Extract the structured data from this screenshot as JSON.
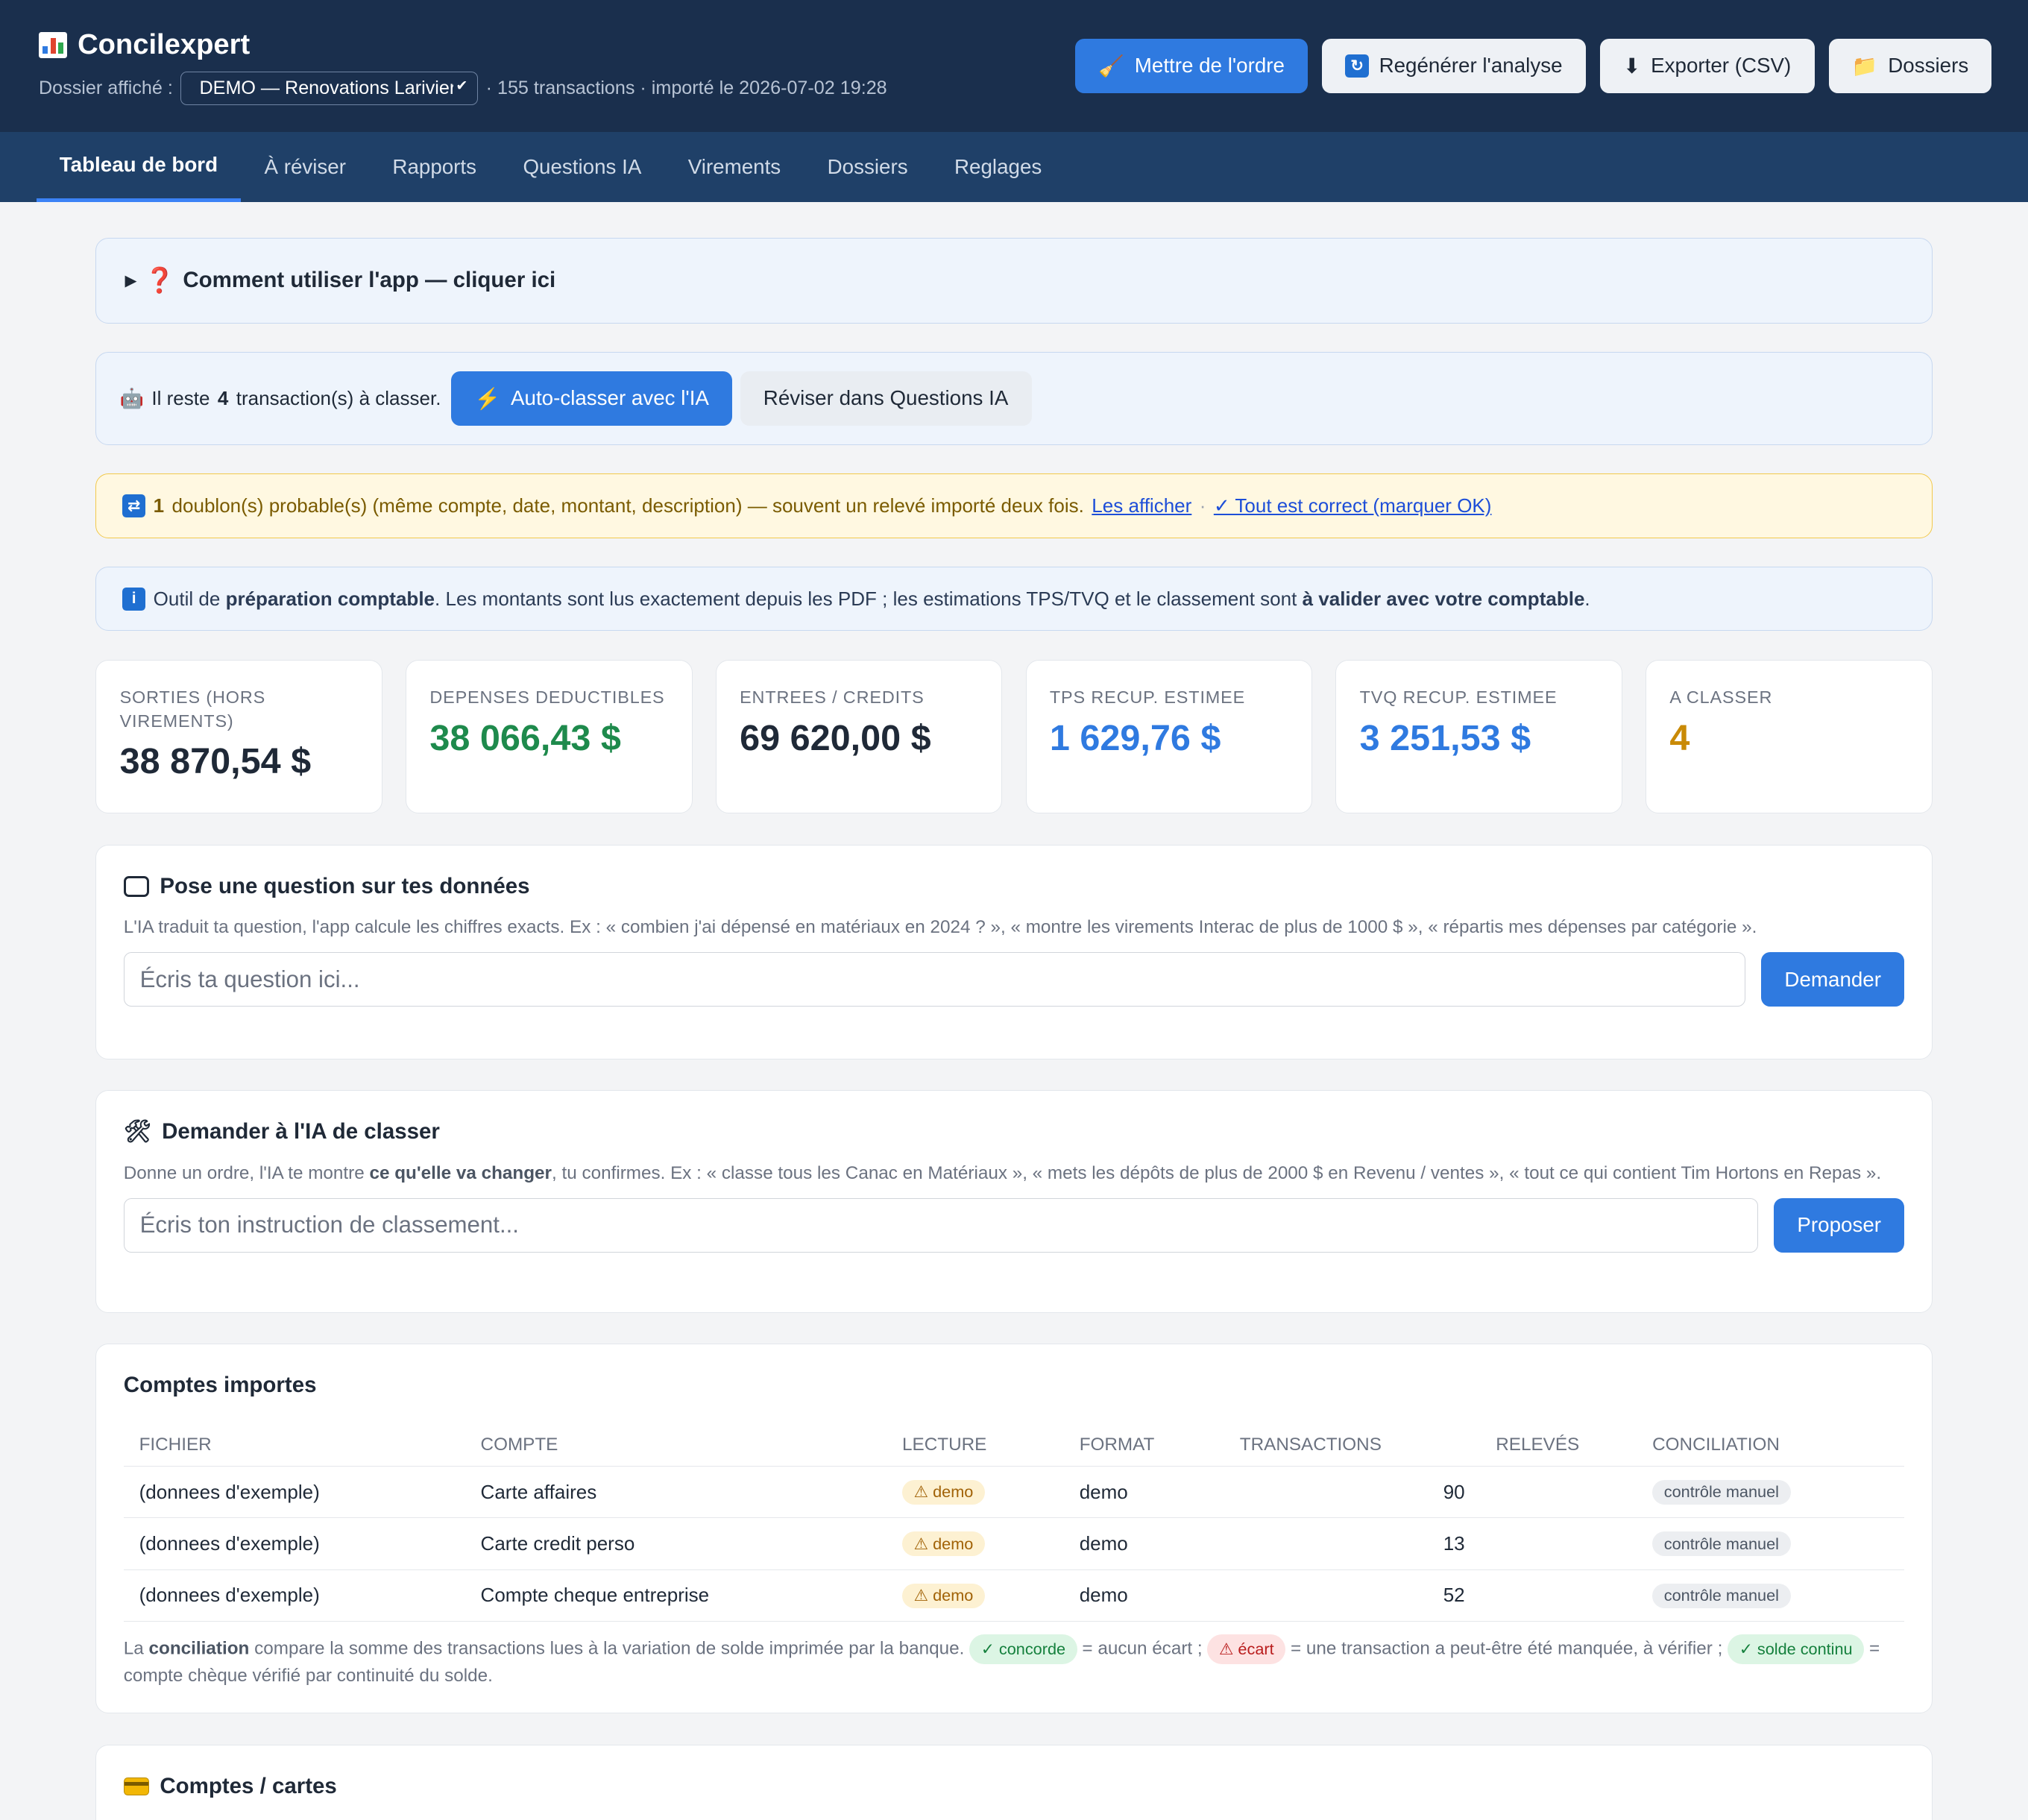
{
  "app": {
    "title": "Concilexpert",
    "dossier_label": "Dossier affiché :",
    "dossier_value": "DEMO — Renovations Lariviere",
    "dossier_meta": "· 155 transactions · importé le 2026-07-02 19:28"
  },
  "actions": {
    "tidy": "Mettre de l'ordre",
    "regen": "Regénérer l'analyse",
    "export": "Exporter (CSV)",
    "folders": "Dossiers"
  },
  "tabs": [
    "Tableau de bord",
    "À réviser",
    "Rapports",
    "Questions IA",
    "Virements",
    "Dossiers",
    "Reglages"
  ],
  "help": {
    "text": "Comment utiliser l'app — cliquer ici"
  },
  "classify": {
    "prefix": "Il reste",
    "count": "4",
    "suffix": "transaction(s) à classer.",
    "auto_button": "Auto-classer avec l'IA",
    "review_button": "Réviser dans Questions IA"
  },
  "duplicates": {
    "count": "1",
    "text": "doublon(s) probable(s) (même compte, date, montant, description) — souvent un relevé importé deux fois.",
    "show_link": "Les afficher",
    "ok_link": "✓ Tout est correct (marquer OK)"
  },
  "info": {
    "p1": "Outil de",
    "b1": "préparation comptable",
    "p2": ". Les montants sont lus exactement depuis les PDF ; les estimations TPS/TVQ et le classement sont",
    "b2": "à valider avec votre comptable",
    "p3": "."
  },
  "stats": [
    {
      "label": "Sorties (hors virements)",
      "value": "38 870,54 $",
      "color": "#1f2937"
    },
    {
      "label": "Depenses deductibles",
      "value": "38 066,43 $",
      "color": "#1e8a4c"
    },
    {
      "label": "Entrees / credits",
      "value": "69 620,00 $",
      "color": "#1f2937"
    },
    {
      "label": "TPS recup. estimee",
      "value": "1 629,76 $",
      "color": "#2f7ae0"
    },
    {
      "label": "TVQ recup. estimee",
      "value": "3 251,53 $",
      "color": "#2f7ae0"
    },
    {
      "label": "A classer",
      "value": "4",
      "color": "#c98a06"
    }
  ],
  "question": {
    "title": "Pose une question sur tes données",
    "desc": "L'IA traduit ta question, l'app calcule les chiffres exacts. Ex : « combien j'ai dépensé en matériaux en 2024 ? », « montre les virements Interac de plus de 1000 $ », « répartis mes dépenses par catégorie ».",
    "placeholder": "Écris ta question ici...",
    "button": "Demander"
  },
  "order": {
    "title": "Demander à l'IA de classer",
    "desc_p1": "Donne un ordre, l'IA te montre",
    "desc_b": "ce qu'elle va changer",
    "desc_p2": ", tu confirmes. Ex : « classe tous les Canac en Matériaux », « mets les dépôts de plus de 2000 $ en Revenu / ventes », « tout ce qui contient Tim Hortons en Repas ».",
    "placeholder": "Écris ton instruction de classement...",
    "button": "Proposer"
  },
  "accounts": {
    "title": "Comptes importes",
    "headers": [
      "Fichier",
      "Compte",
      "Lecture",
      "Format",
      "Transactions",
      "Relevés",
      "Conciliation"
    ],
    "rows": [
      {
        "file": "(donnees d'exemple)",
        "account": "Carte affaires",
        "read": "⚠ demo",
        "format": "demo",
        "tx": "90",
        "rel": "",
        "conc": "contrôle manuel"
      },
      {
        "file": "(donnees d'exemple)",
        "account": "Carte credit perso",
        "read": "⚠ demo",
        "format": "demo",
        "tx": "13",
        "rel": "",
        "conc": "contrôle manuel"
      },
      {
        "file": "(donnees d'exemple)",
        "account": "Compte cheque entreprise",
        "read": "⚠ demo",
        "format": "demo",
        "tx": "52",
        "rel": "",
        "conc": "contrôle manuel"
      }
    ],
    "note_p1": "La",
    "note_b": "conciliation",
    "note_p2": "compare la somme des transactions lues à la variation de solde imprimée par la banque.",
    "pill_ok": "✓ concorde",
    "note_p3": "= aucun écart ;",
    "pill_gap": "⚠ écart",
    "note_p4": "= une transaction a peut-être été manquée, à vérifier ;",
    "pill_cont": "✓ solde continu",
    "note_p5": "= compte chèque vérifié par continuité du solde."
  },
  "cards_section": {
    "title": "Comptes / cartes"
  }
}
